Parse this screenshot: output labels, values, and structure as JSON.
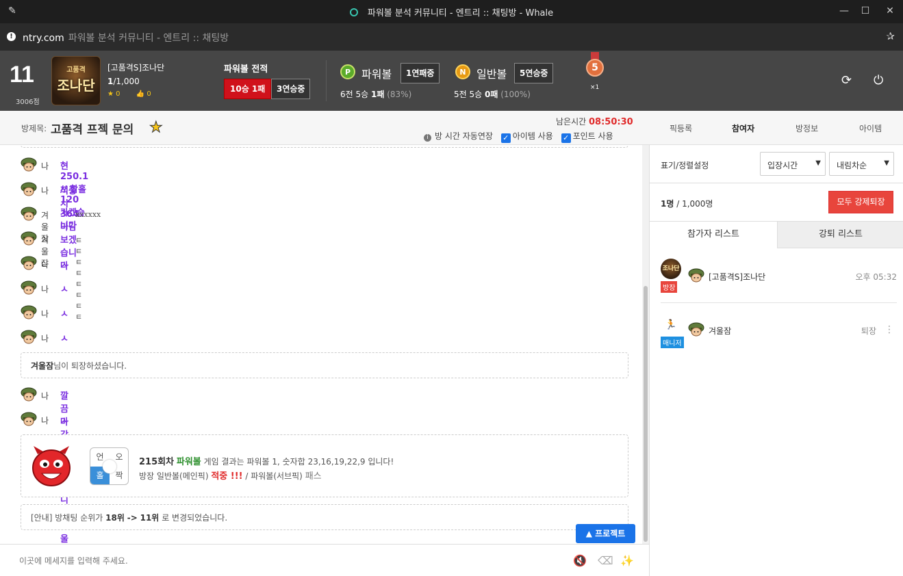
{
  "browser": {
    "title": "파워볼 분석 커뮤니티 - 엔트리 :: 채팅방 - Whale",
    "url_host": "ntry.com",
    "url_title": "파워볼 분석 커뮤니티 - 엔트리 :: 채팅방"
  },
  "header": {
    "rank": "11",
    "points": "3006점",
    "logo_top": "고품격",
    "logo_main": "조나단",
    "owner_name": "[고품격S]조나단",
    "capacity_current": "1",
    "capacity_rest": "/1,000",
    "star_count": "0",
    "like_count": "0",
    "record_title": "파워볼 전적",
    "record_main": "10승 1패",
    "record_streak": "3연승중",
    "powerball": {
      "coin": "P",
      "name": "파워볼",
      "status": "1연패중",
      "stat_main": "6전 5승",
      "stat_bold": "1패",
      "stat_pct": "(83%)"
    },
    "normalball": {
      "coin": "N",
      "name": "일반볼",
      "status": "5연승중",
      "stat_main": "5전 5승",
      "stat_bold": "0패",
      "stat_pct": "(100%)"
    },
    "medal_num": "5",
    "medal_mult": "×1"
  },
  "room": {
    "label": "방제목:",
    "title": "고품격 프젝 문의",
    "remain_label": "남은시간",
    "remain_time": "08:50:30",
    "opt_auto": "방 시간 자동연장",
    "opt_item": "아이템 사용",
    "opt_point": "포인트 사용"
  },
  "right_tabs": [
    "픽등록",
    "참여자",
    "방정보",
    "아이템"
  ],
  "messages": [
    {
      "nick": "나",
      "text": "현 250.1 // 합홀 120 가겠습니다",
      "style": "purple"
    },
    {
      "nick": "나",
      "text": "적중시 364 마감 보겠습니다",
      "style": "purple"
    },
    {
      "nick": "겨울잠",
      "text": "xxxxxx",
      "style": "small"
    },
    {
      "nick": "겨울잠",
      "text": "ㅌㅌㅌㅌㅌㅌㅌㅌ",
      "style": "small"
    },
    {
      "nick": "나",
      "text": "ㅅ",
      "style": "purple"
    },
    {
      "nick": "나",
      "text": "ㅅ",
      "style": "purple"
    },
    {
      "nick": "나",
      "text": "ㅅ",
      "style": "purple"
    },
    {
      "nick": "나",
      "text": "ㅅ",
      "style": "purple"
    }
  ],
  "leave_notice": {
    "name": "겨울잠",
    "text": "님이 퇴장하셨습니다."
  },
  "messages2": [
    {
      "nick": "나",
      "text": "깔끔마감 축하드립니다 겨울잠님",
      "style": "purple"
    },
    {
      "nick": "나",
      "text": "ㅅ",
      "style": "purple"
    }
  ],
  "result": {
    "grid": [
      "언",
      "오",
      "홀",
      "짝"
    ],
    "round": "215회차",
    "game": "파워볼",
    "line1_rest": "게임 결과는 파워볼 1, 숫자합 23,16,19,22,9 입니다!",
    "line2_a": "방장 일반볼(메인픽)",
    "line2_hit": "적중 !!!",
    "line2_b": "/ 파워볼(서브픽)",
    "line2_pass": "패스"
  },
  "rank_notice": {
    "a": "[안내] 방채팅 순위가",
    "from": "18위",
    "arrow": "->",
    "to": "11위",
    "b": "로 변경되었습니다."
  },
  "project_button": "프로젝트",
  "input": {
    "placeholder": "이곳에 메세지를 입력해 주세요."
  },
  "panel": {
    "sort_label": "표기/정렬설정",
    "sort_by": "입장시간",
    "sort_order": "내림차순",
    "count_bold": "1명",
    "count_rest": "/ 1,000명",
    "kick_all": "모두 강제퇴장",
    "tab_participants": "참가자 리스트",
    "tab_kicked": "강퇴 리스트",
    "users": [
      {
        "name": "[고품격S]조나단",
        "badge": "방장",
        "time": "오후 05:32"
      },
      {
        "name": "겨울잠",
        "badge": "매니저",
        "time": "퇴장"
      }
    ]
  },
  "colors": {
    "accent": "#1a73e8",
    "red": "#e8453c",
    "purple": "#7a2ee0",
    "header_bg": "#464646"
  }
}
